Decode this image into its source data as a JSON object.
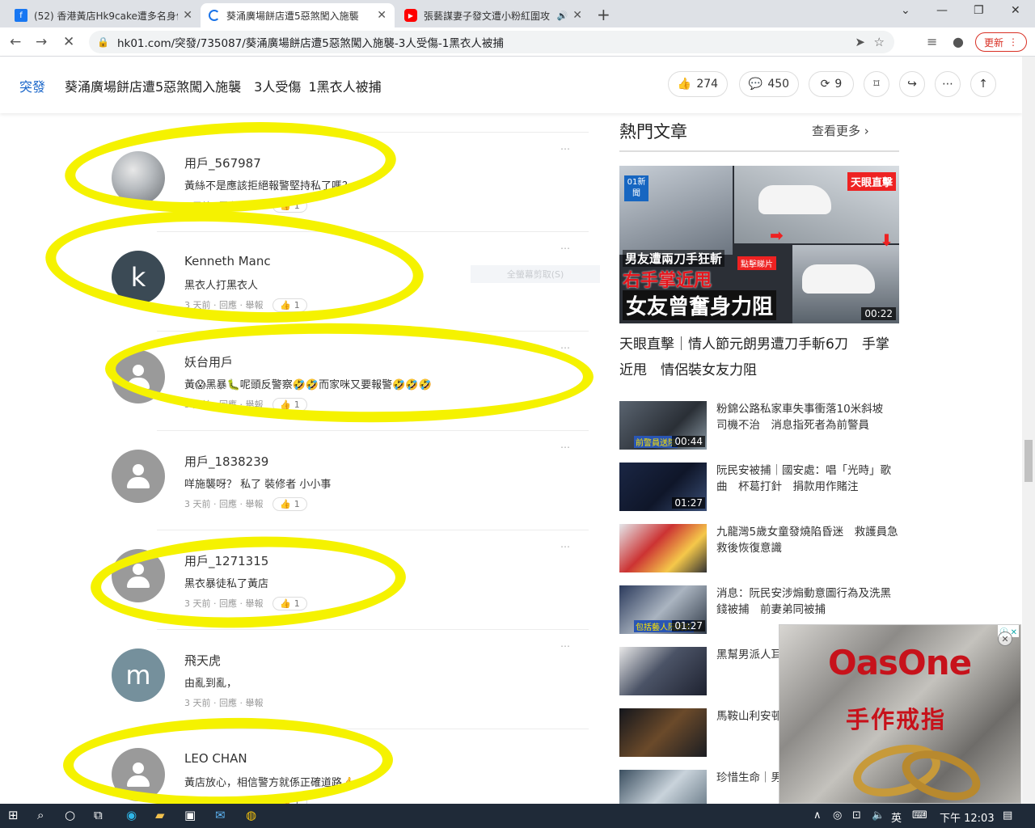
{
  "browser": {
    "tabs": [
      {
        "title": "(52) 香港黃店Hk9cake遭多名身份",
        "icon": "facebook-icon",
        "active": false
      },
      {
        "title": "葵涌廣場餅店遭5惡煞闖入施襲",
        "icon": "loading-spinner-icon",
        "active": true
      },
      {
        "title": "張藝謀妻子發文遭小粉紅圍攻",
        "icon": "youtube-icon",
        "active": false
      }
    ],
    "url": "hk01.com/突發/735087/葵涌廣場餅店遭5惡煞闖入施襲-3人受傷-1黑衣人被捕",
    "update_label": "更新"
  },
  "header": {
    "breadcrumb": "突發",
    "title": "葵涌廣場餅店遭5惡煞闖入施襲　3人受傷 1黑衣人被捕",
    "likes": "274",
    "comments": "450",
    "shares": "9"
  },
  "comments": [
    {
      "name": "用戶_567987",
      "text": "黃絲不是應該拒絕報警堅持私了嗎？",
      "time": "3 天前",
      "reply": "回應",
      "report": "舉報",
      "likes": "1",
      "avatar": "cloud"
    },
    {
      "name": "Kenneth Manc",
      "text": "黑衣人打黑衣人",
      "time": "3 天前",
      "reply": "回應",
      "report": "舉報",
      "likes": "1",
      "avatar": "k",
      "initial": "k"
    },
    {
      "name": "妖台用戶",
      "text": "黃😱黑暴🐛呢頭反警察🤣🤣而家咪又要報警🤣🤣🤣",
      "time": "3 天前",
      "reply": "回應",
      "report": "舉報",
      "likes": "1",
      "avatar": "person"
    },
    {
      "name": "用戶_1838239",
      "text": "咩施襲呀？ 私了 裝修者 小小事",
      "time": "3 天前",
      "reply": "回應",
      "report": "舉報",
      "likes": "1",
      "avatar": "person"
    },
    {
      "name": "用戶_1271315",
      "text": "黑衣暴徒私了黃店",
      "time": "3 天前",
      "reply": "回應",
      "report": "舉報",
      "likes": "1",
      "avatar": "person"
    },
    {
      "name": "飛天虎",
      "text": "由亂到亂，",
      "time": "3 天前",
      "reply": "回應",
      "report": "舉報",
      "likes": "",
      "avatar": "m",
      "initial": "m"
    },
    {
      "name": "LEO CHAN",
      "text": "黃店放心，相信警方就係正確道路👍",
      "time": "3 天前",
      "reply": "回應",
      "report": "舉報",
      "likes": "1",
      "avatar": "person"
    }
  ],
  "ghost_button": "全螢幕剪取(S)",
  "sidebar": {
    "title": "熱門文章",
    "more": "查看更多",
    "hero": {
      "title": "天眼直擊｜情人節元朗男遭刀手斬6刀　手掌近甩　情侶裝女友力阻",
      "duration": "00:22",
      "badge": "天眼直擊",
      "caption1": "男友遭兩刀手狂斬",
      "caption2": "右手掌近甩",
      "caption3": "女友曾奮身力阻",
      "click_label": "點擊睇片",
      "logo": "01新聞"
    },
    "related": [
      {
        "text": "粉錦公路私家車失事衝落10米斜坡　司機不治　消息指死者為前警員",
        "duration": "00:44",
        "label": "前警員送院"
      },
      {
        "text": "阮民安被捕｜國安處：唱「光時」歌曲　杯葛打針　捐款用作賭注",
        "duration": "01:27",
        "label": ""
      },
      {
        "text": "九龍灣5歲女童發燒陷昏迷　救護員急救後恢復意識",
        "duration": "",
        "label": ""
      },
      {
        "text": "消息：阮民安涉煽動意圖行為及洗黑錢被捕　前妻弟同被捕",
        "duration": "01:27",
        "label": "包括藝人阮民安"
      },
      {
        "text": "黑幫男派人耳　「吹大咗」私",
        "duration": "",
        "label": ""
      },
      {
        "text": "馬鞍山利安邨　組調查　褒",
        "duration": "",
        "label": ""
      },
      {
        "text": "珍惜生命｜男　亡",
        "duration": "",
        "label": ""
      }
    ]
  },
  "ad": {
    "brand": "OasOne",
    "subtitle": "手作戒指"
  },
  "taskbar": {
    "ime": "英",
    "time": "下午 12:03"
  }
}
